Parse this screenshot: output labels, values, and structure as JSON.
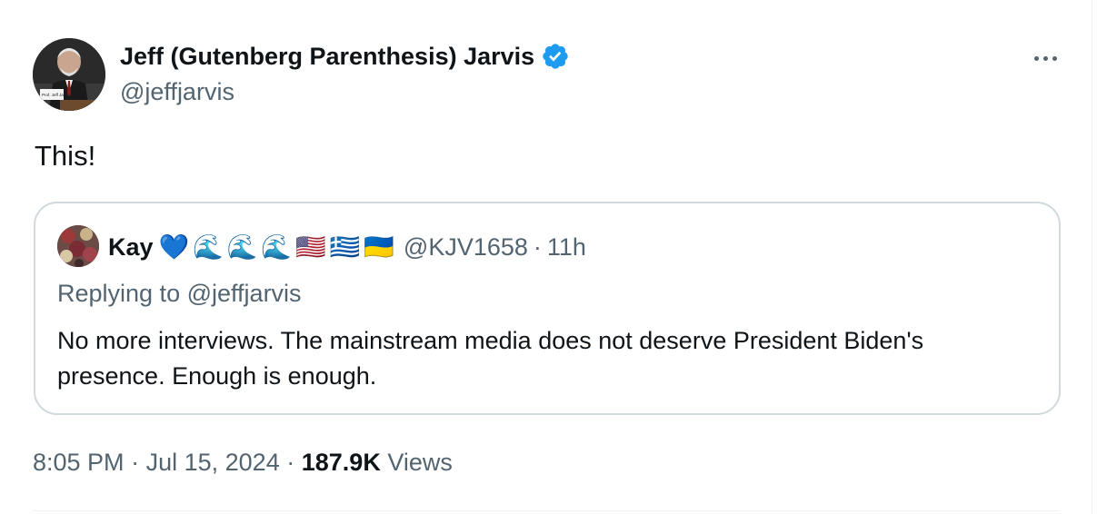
{
  "author": {
    "display_name": "Jeff (Gutenberg Parenthesis) Jarvis",
    "handle": "@jeffjarvis",
    "avatar_caption": "Prof. Jeff Jarvis",
    "verified": true,
    "verified_color": "#1d9bf0"
  },
  "tweet": {
    "text": "This!",
    "time": "8:05 PM",
    "date": "Jul 15, 2024",
    "separator": "·",
    "views_count": "187.9K",
    "views_label": "Views"
  },
  "quoted": {
    "display_name": "Kay",
    "name_emojis": [
      "💙",
      "🌊",
      "🌊",
      "🌊",
      "🇺🇸",
      "🇬🇷",
      "🇺🇦"
    ],
    "handle": "@KJV1658",
    "separator": "·",
    "age": "11h",
    "replying_label": "Replying to",
    "replying_to": "@jeffjarvis",
    "text": "No more interviews. The mainstream media does not deserve President Biden's presence. Enough is enough."
  },
  "icons": {
    "more": "more-horizontal-icon",
    "verified": "verified-badge-icon"
  },
  "colors": {
    "primary_text": "#0f1419",
    "secondary_text": "#536471",
    "border": "#cfd9de",
    "accent": "#1d9bf0"
  }
}
